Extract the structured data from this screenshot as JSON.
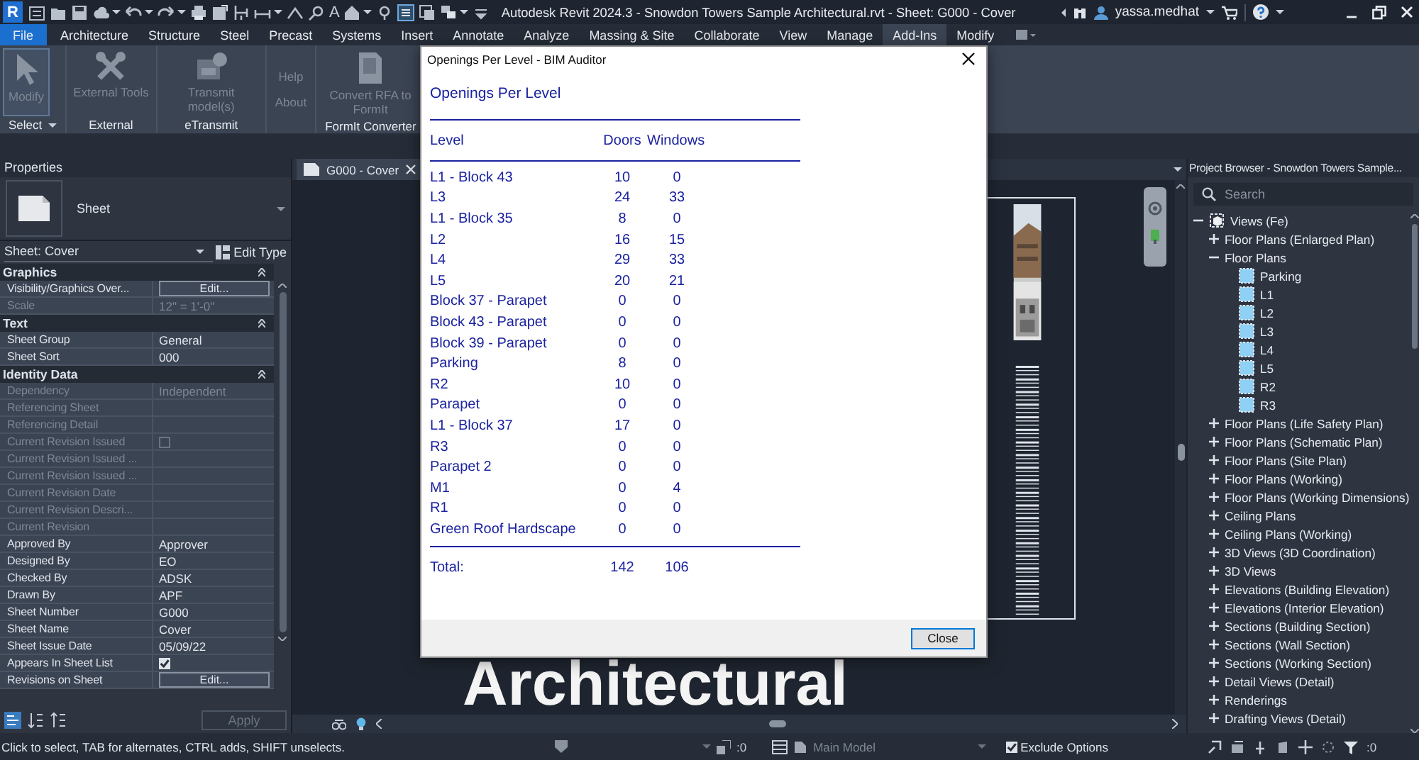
{
  "title_bar": {
    "logo": "R",
    "quick_access": [
      {
        "kind": "tool"
      },
      {
        "kind": "tool"
      },
      {
        "kind": "tool"
      },
      {
        "kind": "tool",
        "menu": true
      },
      {
        "kind": "tool",
        "menu": true
      },
      {
        "kind": "tool",
        "menu": true
      },
      {
        "kind": "tool"
      },
      {
        "kind": "tool"
      },
      {
        "kind": "tool"
      },
      {
        "kind": "tool",
        "menu": true
      },
      {
        "kind": "tool"
      },
      {
        "kind": "tool"
      },
      {
        "kind": "text",
        "label": "A"
      },
      {
        "kind": "tool",
        "menu": true
      },
      {
        "kind": "tool"
      },
      {
        "kind": "tool"
      },
      {
        "kind": "tool"
      },
      {
        "kind": "tool",
        "menu": true
      },
      {
        "kind": "tool"
      }
    ],
    "title": "Autodesk Revit 2024.3 - Snowdon Towers Sample Architectural.rvt - Sheet: G000 - Cover",
    "user": "yassa.medhat"
  },
  "ribbon_tabs": [
    {
      "label": "File",
      "kind": "file",
      "selected": false
    },
    {
      "label": "Architecture",
      "kind": "tab",
      "selected": false
    },
    {
      "label": "Structure",
      "kind": "tab",
      "selected": false
    },
    {
      "label": "Steel",
      "kind": "tab",
      "selected": false
    },
    {
      "label": "Precast",
      "kind": "tab",
      "selected": false
    },
    {
      "label": "Systems",
      "kind": "tab",
      "selected": false
    },
    {
      "label": "Insert",
      "kind": "tab",
      "selected": false
    },
    {
      "label": "Annotate",
      "kind": "tab",
      "selected": false
    },
    {
      "label": "Analyze",
      "kind": "tab",
      "selected": false
    },
    {
      "label": "Massing & Site",
      "kind": "tab",
      "selected": false
    },
    {
      "label": "Collaborate",
      "kind": "tab",
      "selected": false
    },
    {
      "label": "View",
      "kind": "tab",
      "selected": false
    },
    {
      "label": "Manage",
      "kind": "tab",
      "selected": false
    },
    {
      "label": "Add-Ins",
      "kind": "tab",
      "selected": true
    },
    {
      "label": "Modify",
      "kind": "tab",
      "selected": false
    }
  ],
  "ribbon_panels": [
    {
      "label": "Select",
      "menu": true,
      "buttons": [
        {
          "label": "Modify",
          "kind": "large",
          "selected": true,
          "disabled": true
        }
      ]
    },
    {
      "label": "External",
      "buttons": [
        {
          "label": "External Tools",
          "kind": "large",
          "selected": false,
          "disabled": true
        }
      ]
    },
    {
      "label": "eTransmit",
      "buttons": [
        {
          "label": "Transmit model(s)",
          "kind": "large",
          "selected": false,
          "disabled": true
        }
      ]
    },
    {
      "buttons": [
        {
          "label": "Help",
          "kind": "small",
          "selected": false,
          "disabled": true
        },
        {
          "label": "About",
          "kind": "small",
          "selected": false,
          "disabled": true
        }
      ]
    },
    {
      "label": "FormIt Converter",
      "buttons": [
        {
          "label": "Convert RFA to FormIt",
          "kind": "large",
          "selected": false,
          "disabled": true
        }
      ]
    }
  ],
  "properties": {
    "title": "Properties",
    "type_name": "Sheet",
    "type_selector": "Sheet: Cover",
    "edit_type": "Edit Type",
    "apply": "Apply",
    "groups": [
      {
        "label": "Graphics",
        "expanded": true,
        "rows": [
          {
            "name": "Visibility/Graphics Over...",
            "value": "Edit...",
            "kind": "button",
            "disabled": false
          },
          {
            "name": "Scale",
            "value": "12\" = 1'-0\"",
            "kind": "text",
            "disabled": true
          }
        ]
      },
      {
        "label": "Text",
        "expanded": true,
        "rows": [
          {
            "name": "Sheet Group",
            "value": "General",
            "kind": "text",
            "disabled": false
          },
          {
            "name": "Sheet Sort",
            "value": "000",
            "kind": "text",
            "disabled": false
          }
        ]
      },
      {
        "label": "Identity Data",
        "expanded": true,
        "rows": [
          {
            "name": "Dependency",
            "value": "Independent",
            "kind": "text",
            "disabled": true
          },
          {
            "name": "Referencing Sheet",
            "kind": "text",
            "disabled": true
          },
          {
            "name": "Referencing Detail",
            "kind": "text",
            "disabled": true
          },
          {
            "name": "Current Revision Issued",
            "kind": "checkbox",
            "checked": false,
            "disabled": true
          },
          {
            "name": "Current Revision Issued ...",
            "kind": "text",
            "disabled": true
          },
          {
            "name": "Current Revision Issued ...",
            "kind": "text",
            "disabled": true
          },
          {
            "name": "Current Revision Date",
            "kind": "text",
            "disabled": true
          },
          {
            "name": "Current Revision Descri...",
            "kind": "text",
            "disabled": true
          },
          {
            "name": "Current Revision",
            "kind": "text",
            "disabled": true
          },
          {
            "name": "Approved By",
            "value": "Approver",
            "kind": "text",
            "disabled": false
          },
          {
            "name": "Designed By",
            "value": "EO",
            "kind": "text",
            "disabled": false
          },
          {
            "name": "Checked By",
            "value": "ADSK",
            "kind": "text",
            "disabled": false
          },
          {
            "name": "Drawn By",
            "value": "APF",
            "kind": "text",
            "disabled": false
          },
          {
            "name": "Sheet Number",
            "value": "G000",
            "kind": "text",
            "disabled": false
          },
          {
            "name": "Sheet Name",
            "value": "Cover",
            "kind": "text",
            "disabled": false
          },
          {
            "name": "Sheet Issue Date",
            "value": "05/09/22",
            "kind": "text",
            "disabled": false
          },
          {
            "name": "Appears In Sheet List",
            "kind": "checkbox",
            "checked": true,
            "disabled": false
          },
          {
            "name": "Revisions on Sheet",
            "value": "Edit...",
            "kind": "button",
            "disabled": false
          }
        ]
      }
    ]
  },
  "view": {
    "tab": "G000 - Cover",
    "sheet_title": "Architectural"
  },
  "project_browser": {
    "title": "Project Browser - Snowdon Towers Sample...",
    "search_placeholder": "Search",
    "tree": [
      {
        "label": "Views (Fe)",
        "kind": "root",
        "expanded": true,
        "children": [
          {
            "label": "Floor Plans (Enlarged Plan)",
            "kind": "group",
            "expanded": false
          },
          {
            "label": "Floor Plans",
            "kind": "group",
            "expanded": true,
            "children": [
              {
                "label": "Parking",
                "kind": "view"
              },
              {
                "label": "L1",
                "kind": "view"
              },
              {
                "label": "L2",
                "kind": "view"
              },
              {
                "label": "L3",
                "kind": "view"
              },
              {
                "label": "L4",
                "kind": "view"
              },
              {
                "label": "L5",
                "kind": "view"
              },
              {
                "label": "R2",
                "kind": "view"
              },
              {
                "label": "R3",
                "kind": "view"
              }
            ]
          },
          {
            "label": "Floor Plans (Life Safety Plan)",
            "kind": "group",
            "expanded": false
          },
          {
            "label": "Floor Plans (Schematic Plan)",
            "kind": "group",
            "expanded": false
          },
          {
            "label": "Floor Plans (Site Plan)",
            "kind": "group",
            "expanded": false
          },
          {
            "label": "Floor Plans (Working)",
            "kind": "group",
            "expanded": false
          },
          {
            "label": "Floor Plans (Working Dimensions)",
            "kind": "group",
            "expanded": false
          },
          {
            "label": "Ceiling Plans",
            "kind": "group",
            "expanded": false
          },
          {
            "label": "Ceiling Plans (Working)",
            "kind": "group",
            "expanded": false
          },
          {
            "label": "3D Views (3D Coordination)",
            "kind": "group",
            "expanded": false
          },
          {
            "label": "3D Views",
            "kind": "group",
            "expanded": false
          },
          {
            "label": "Elevations (Building Elevation)",
            "kind": "group",
            "expanded": false
          },
          {
            "label": "Elevations (Interior Elevation)",
            "kind": "group",
            "expanded": false
          },
          {
            "label": "Sections (Building Section)",
            "kind": "group",
            "expanded": false
          },
          {
            "label": "Sections (Wall Section)",
            "kind": "group",
            "expanded": false
          },
          {
            "label": "Sections (Working Section)",
            "kind": "group",
            "expanded": false
          },
          {
            "label": "Detail Views (Detail)",
            "kind": "group",
            "expanded": false
          },
          {
            "label": "Renderings",
            "kind": "group",
            "expanded": false
          },
          {
            "label": "Drafting Views (Detail)",
            "kind": "group",
            "expanded": false
          }
        ]
      }
    ]
  },
  "dialog": {
    "title": "Openings Per Level - BIM Auditor",
    "heading": "Openings Per Level",
    "columns": [
      "Level",
      "Doors",
      "Windows"
    ],
    "rows": [
      {
        "level": "L1 - Block 43",
        "doors": "10",
        "windows": "0"
      },
      {
        "level": "L3",
        "doors": "24",
        "windows": "33"
      },
      {
        "level": "L1 - Block 35",
        "doors": "8",
        "windows": "0"
      },
      {
        "level": "L2",
        "doors": "16",
        "windows": "15"
      },
      {
        "level": "L4",
        "doors": "29",
        "windows": "33"
      },
      {
        "level": "L5",
        "doors": "20",
        "windows": "21"
      },
      {
        "level": "Block 37 - Parapet",
        "doors": "0",
        "windows": "0"
      },
      {
        "level": "Block 43 - Parapet",
        "doors": "0",
        "windows": "0"
      },
      {
        "level": "Block 39 - Parapet",
        "doors": "0",
        "windows": "0"
      },
      {
        "level": "Parking",
        "doors": "8",
        "windows": "0"
      },
      {
        "level": "R2",
        "doors": "10",
        "windows": "0"
      },
      {
        "level": "Parapet",
        "doors": "0",
        "windows": "0"
      },
      {
        "level": "L1 - Block 37",
        "doors": "17",
        "windows": "0"
      },
      {
        "level": "R3",
        "doors": "0",
        "windows": "0"
      },
      {
        "level": "Parapet 2",
        "doors": "0",
        "windows": "0"
      },
      {
        "level": "M1",
        "doors": "0",
        "windows": "4"
      },
      {
        "level": "R1",
        "doors": "0",
        "windows": "0"
      },
      {
        "level": "Green Roof Hardscape",
        "doors": "0",
        "windows": "0"
      }
    ],
    "total": {
      "label": "Total:",
      "doors": "142",
      "windows": "106"
    },
    "close": "Close"
  },
  "status_bar": {
    "message": "Click to select, TAB for alternates, CTRL adds, SHIFT unselects.",
    "worksharing_count": ":0",
    "model": "Main Model",
    "exclude_options": {
      "label": "Exclude Options",
      "checked": true
    },
    "filter_count": ":0"
  }
}
